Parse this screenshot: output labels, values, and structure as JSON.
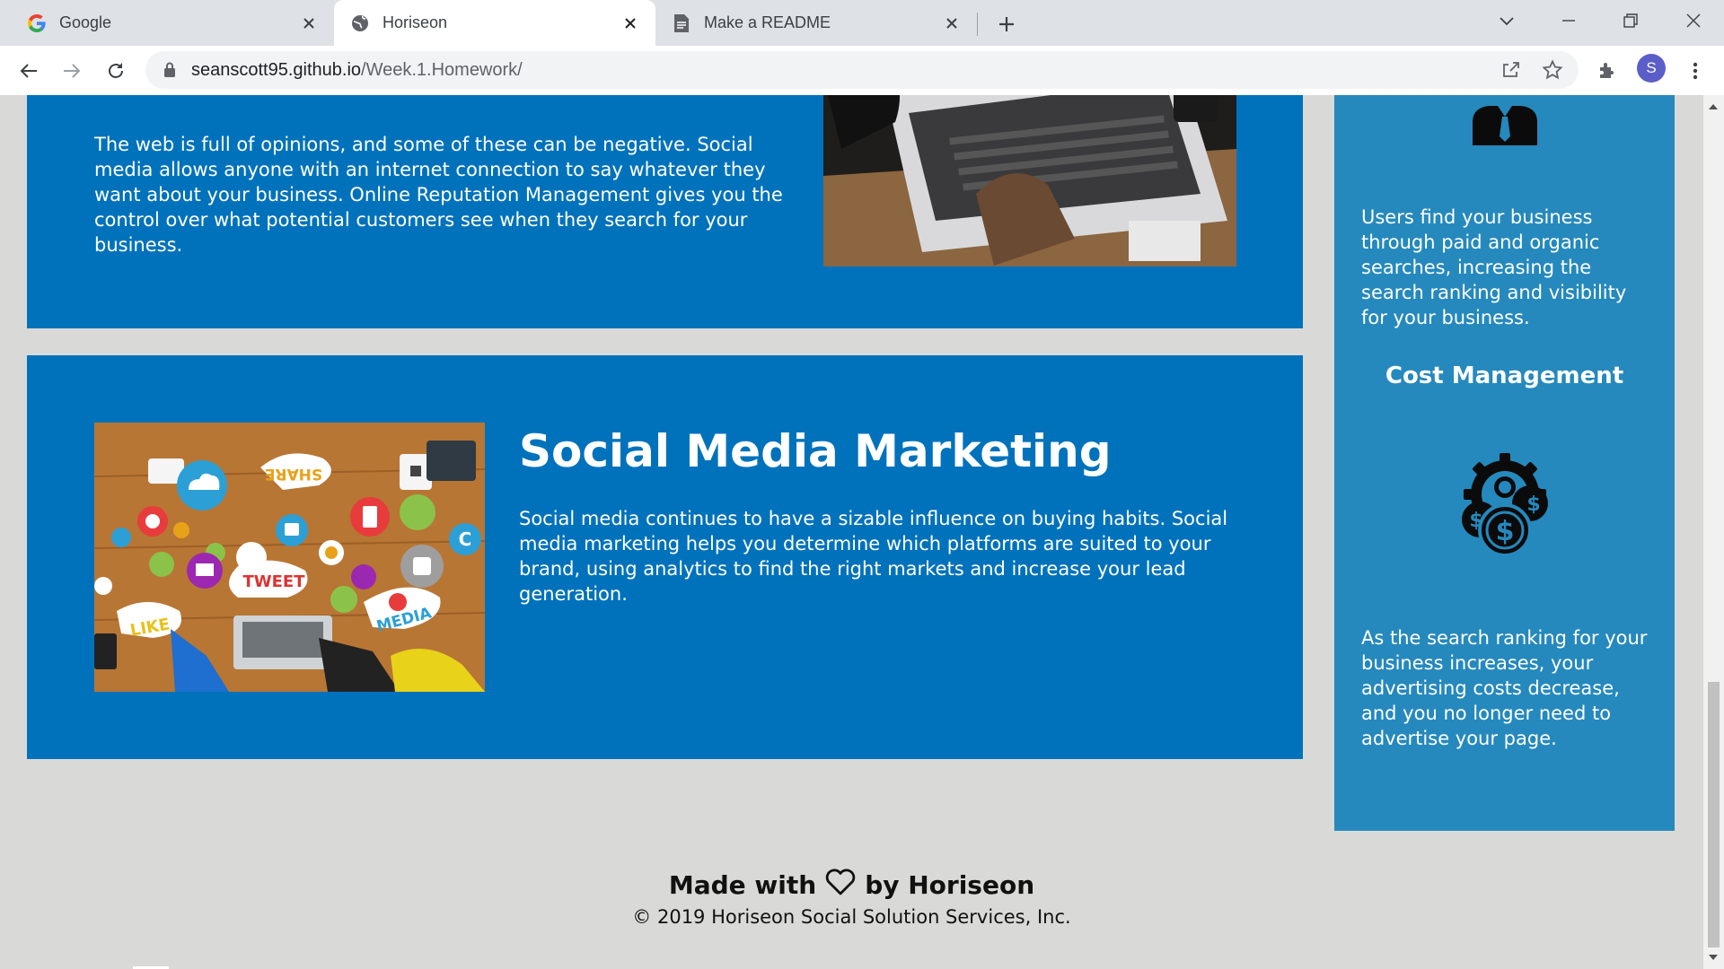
{
  "browser": {
    "tabs": [
      {
        "title": "Google",
        "favicon": "google-g-icon"
      },
      {
        "title": "Horiseon",
        "favicon": "globe-icon",
        "active": true
      },
      {
        "title": "Make a README",
        "favicon": "document-icon"
      }
    ],
    "url_host": "seanscott95.github.io",
    "url_path": "/Week.1.Homework/",
    "profile_initial": "S"
  },
  "page": {
    "card1": {
      "text": "The web is full of opinions, and some of these can be negative. Social media allows anyone with an internet connection to say whatever they want about your business. Online Reputation Management gives you the control over what potential customers see when they search for your business."
    },
    "card2": {
      "heading": "Social Media Marketing",
      "text": "Social media continues to have a sizable influence on buying habits. Social media marketing helps you determine which platforms are suited to your brand, using analytics to find the right markets and increase your lead generation.",
      "image_words": [
        "SHARE",
        "TWEET",
        "LIKE",
        "MEDIA"
      ]
    },
    "aside": {
      "p1": "Users find your business through paid and organic searches, increasing the search ranking and visibility for your business.",
      "heading": "Cost Management",
      "p2": "As the search ranking for your business increases, your advertising costs decrease, and you no longer need to advertise your page."
    },
    "footer": {
      "made_prefix": "Made with",
      "made_suffix": "by Horiseon",
      "copyright": "© 2019 Horiseon Social Solution Services, Inc."
    }
  },
  "colors": {
    "card_blue": "#0072bb",
    "aside_blue": "#2589bd",
    "page_bg": "#d9dad7"
  }
}
